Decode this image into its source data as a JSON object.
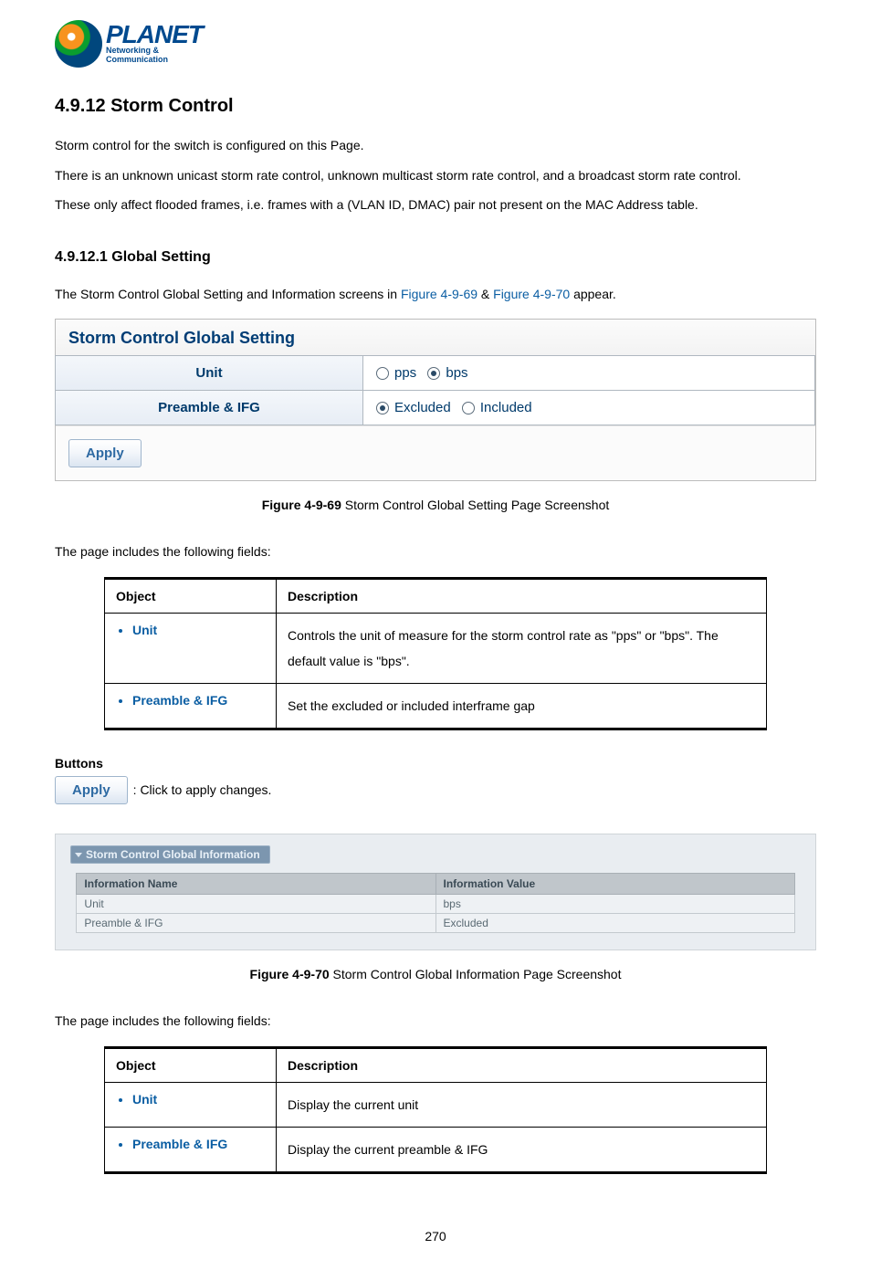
{
  "logo": {
    "brand": "PLANET",
    "tagline": "Networking & Communication"
  },
  "section": {
    "number": "4.9.12",
    "title": "Storm Control"
  },
  "intro": {
    "p1": "Storm control for the switch is configured on this Page.",
    "p2": "There is an unknown unicast storm rate control, unknown multicast storm rate control, and a broadcast storm rate control.",
    "p3": "These only affect flooded frames, i.e. frames with a (VLAN ID, DMAC) pair not present on the MAC Address table."
  },
  "subsection": {
    "number": "4.9.12.1",
    "title": "Global Setting"
  },
  "subintro": {
    "pre": "The Storm Control Global Setting and Information screens in ",
    "ref1": "Figure 4-9-69",
    "amp": " & ",
    "ref2": "Figure 4-9-70",
    "post": " appear."
  },
  "settingPanel": {
    "title": "Storm Control Global Setting",
    "rows": [
      {
        "label": "Unit",
        "opts": [
          {
            "label": "pps",
            "checked": false
          },
          {
            "label": "bps",
            "checked": true
          }
        ]
      },
      {
        "label": "Preamble & IFG",
        "opts": [
          {
            "label": "Excluded",
            "checked": true
          },
          {
            "label": "Included",
            "checked": false
          }
        ]
      }
    ],
    "apply": "Apply"
  },
  "fig69": {
    "label": "Figure 4-9-69",
    "text": " Storm Control Global Setting Page Screenshot"
  },
  "fieldsIntro": "The page includes the following fields:",
  "descTable1": {
    "headers": {
      "obj": "Object",
      "desc": "Description"
    },
    "rows": [
      {
        "obj": "Unit",
        "desc": "Controls the unit of measure for the storm control rate as \"pps\" or \"bps\". The default value is \"bps\"."
      },
      {
        "obj": "Preamble & IFG",
        "desc": "Set the excluded or included interframe gap"
      }
    ]
  },
  "buttons": {
    "header": "Buttons",
    "applyLabel": "Apply",
    "applyDesc": ": Click to apply changes."
  },
  "infoPanel": {
    "legend": "Storm Control Global Information",
    "headers": {
      "name": "Information Name",
      "value": "Information Value"
    },
    "rows": [
      {
        "name": "Unit",
        "value": "bps"
      },
      {
        "name": "Preamble & IFG",
        "value": "Excluded"
      }
    ]
  },
  "fig70": {
    "label": "Figure 4-9-70",
    "text": " Storm Control Global Information Page Screenshot"
  },
  "fieldsIntro2": "The page includes the following fields:",
  "descTable2": {
    "headers": {
      "obj": "Object",
      "desc": "Description"
    },
    "rows": [
      {
        "obj": "Unit",
        "desc": "Display the current unit"
      },
      {
        "obj": "Preamble & IFG",
        "desc": "Display the current preamble & IFG"
      }
    ]
  },
  "pageNumber": "270"
}
